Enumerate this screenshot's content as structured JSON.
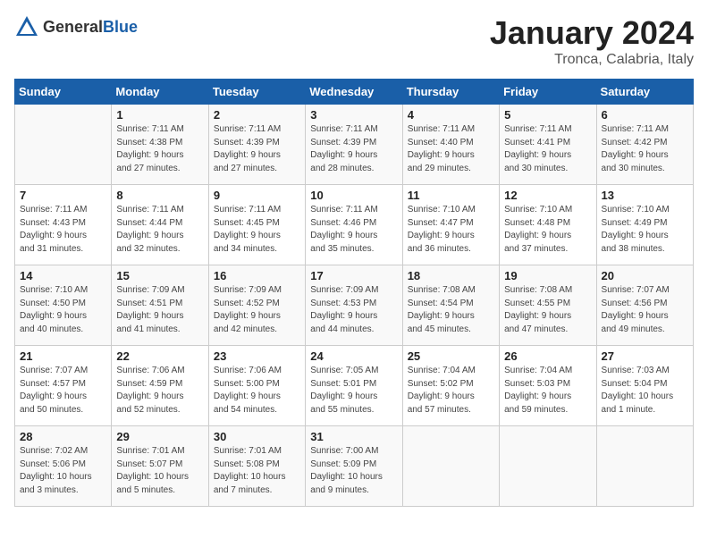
{
  "logo": {
    "general": "General",
    "blue": "Blue"
  },
  "title": "January 2024",
  "location": "Tronca, Calabria, Italy",
  "days_of_week": [
    "Sunday",
    "Monday",
    "Tuesday",
    "Wednesday",
    "Thursday",
    "Friday",
    "Saturday"
  ],
  "weeks": [
    [
      {
        "day": "",
        "info": ""
      },
      {
        "day": "1",
        "info": "Sunrise: 7:11 AM\nSunset: 4:38 PM\nDaylight: 9 hours\nand 27 minutes."
      },
      {
        "day": "2",
        "info": "Sunrise: 7:11 AM\nSunset: 4:39 PM\nDaylight: 9 hours\nand 27 minutes."
      },
      {
        "day": "3",
        "info": "Sunrise: 7:11 AM\nSunset: 4:39 PM\nDaylight: 9 hours\nand 28 minutes."
      },
      {
        "day": "4",
        "info": "Sunrise: 7:11 AM\nSunset: 4:40 PM\nDaylight: 9 hours\nand 29 minutes."
      },
      {
        "day": "5",
        "info": "Sunrise: 7:11 AM\nSunset: 4:41 PM\nDaylight: 9 hours\nand 30 minutes."
      },
      {
        "day": "6",
        "info": "Sunrise: 7:11 AM\nSunset: 4:42 PM\nDaylight: 9 hours\nand 30 minutes."
      }
    ],
    [
      {
        "day": "7",
        "info": "Sunrise: 7:11 AM\nSunset: 4:43 PM\nDaylight: 9 hours\nand 31 minutes."
      },
      {
        "day": "8",
        "info": "Sunrise: 7:11 AM\nSunset: 4:44 PM\nDaylight: 9 hours\nand 32 minutes."
      },
      {
        "day": "9",
        "info": "Sunrise: 7:11 AM\nSunset: 4:45 PM\nDaylight: 9 hours\nand 34 minutes."
      },
      {
        "day": "10",
        "info": "Sunrise: 7:11 AM\nSunset: 4:46 PM\nDaylight: 9 hours\nand 35 minutes."
      },
      {
        "day": "11",
        "info": "Sunrise: 7:10 AM\nSunset: 4:47 PM\nDaylight: 9 hours\nand 36 minutes."
      },
      {
        "day": "12",
        "info": "Sunrise: 7:10 AM\nSunset: 4:48 PM\nDaylight: 9 hours\nand 37 minutes."
      },
      {
        "day": "13",
        "info": "Sunrise: 7:10 AM\nSunset: 4:49 PM\nDaylight: 9 hours\nand 38 minutes."
      }
    ],
    [
      {
        "day": "14",
        "info": "Sunrise: 7:10 AM\nSunset: 4:50 PM\nDaylight: 9 hours\nand 40 minutes."
      },
      {
        "day": "15",
        "info": "Sunrise: 7:09 AM\nSunset: 4:51 PM\nDaylight: 9 hours\nand 41 minutes."
      },
      {
        "day": "16",
        "info": "Sunrise: 7:09 AM\nSunset: 4:52 PM\nDaylight: 9 hours\nand 42 minutes."
      },
      {
        "day": "17",
        "info": "Sunrise: 7:09 AM\nSunset: 4:53 PM\nDaylight: 9 hours\nand 44 minutes."
      },
      {
        "day": "18",
        "info": "Sunrise: 7:08 AM\nSunset: 4:54 PM\nDaylight: 9 hours\nand 45 minutes."
      },
      {
        "day": "19",
        "info": "Sunrise: 7:08 AM\nSunset: 4:55 PM\nDaylight: 9 hours\nand 47 minutes."
      },
      {
        "day": "20",
        "info": "Sunrise: 7:07 AM\nSunset: 4:56 PM\nDaylight: 9 hours\nand 49 minutes."
      }
    ],
    [
      {
        "day": "21",
        "info": "Sunrise: 7:07 AM\nSunset: 4:57 PM\nDaylight: 9 hours\nand 50 minutes."
      },
      {
        "day": "22",
        "info": "Sunrise: 7:06 AM\nSunset: 4:59 PM\nDaylight: 9 hours\nand 52 minutes."
      },
      {
        "day": "23",
        "info": "Sunrise: 7:06 AM\nSunset: 5:00 PM\nDaylight: 9 hours\nand 54 minutes."
      },
      {
        "day": "24",
        "info": "Sunrise: 7:05 AM\nSunset: 5:01 PM\nDaylight: 9 hours\nand 55 minutes."
      },
      {
        "day": "25",
        "info": "Sunrise: 7:04 AM\nSunset: 5:02 PM\nDaylight: 9 hours\nand 57 minutes."
      },
      {
        "day": "26",
        "info": "Sunrise: 7:04 AM\nSunset: 5:03 PM\nDaylight: 9 hours\nand 59 minutes."
      },
      {
        "day": "27",
        "info": "Sunrise: 7:03 AM\nSunset: 5:04 PM\nDaylight: 10 hours\nand 1 minute."
      }
    ],
    [
      {
        "day": "28",
        "info": "Sunrise: 7:02 AM\nSunset: 5:06 PM\nDaylight: 10 hours\nand 3 minutes."
      },
      {
        "day": "29",
        "info": "Sunrise: 7:01 AM\nSunset: 5:07 PM\nDaylight: 10 hours\nand 5 minutes."
      },
      {
        "day": "30",
        "info": "Sunrise: 7:01 AM\nSunset: 5:08 PM\nDaylight: 10 hours\nand 7 minutes."
      },
      {
        "day": "31",
        "info": "Sunrise: 7:00 AM\nSunset: 5:09 PM\nDaylight: 10 hours\nand 9 minutes."
      },
      {
        "day": "",
        "info": ""
      },
      {
        "day": "",
        "info": ""
      },
      {
        "day": "",
        "info": ""
      }
    ]
  ]
}
